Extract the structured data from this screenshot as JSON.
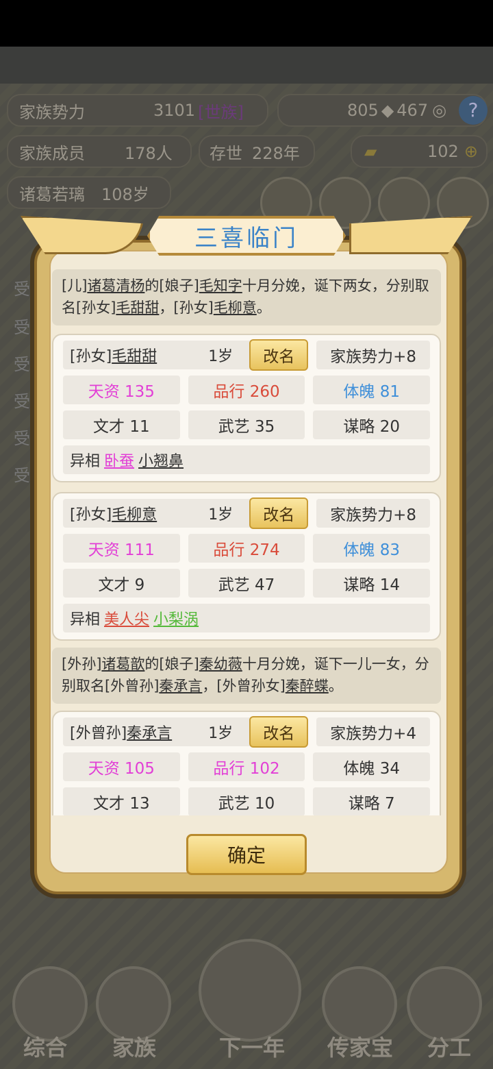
{
  "background": {
    "family_power_label": "家族势力",
    "family_power_value": "3101",
    "family_power_rank": "[世族]",
    "currency_a": "805",
    "currency_b": "467",
    "members_label": "家族成员",
    "members_value": "178人",
    "existence_label": "存世",
    "existence_value": "228年",
    "gold_value": "102",
    "patriarch_name": "诸葛若璃",
    "patriarch_age": "108岁",
    "side_labels": [
      "受",
      "受",
      "受",
      "受",
      "受",
      "受"
    ],
    "nav": [
      "综合",
      "家族",
      "下一年",
      "传家宝",
      "分工"
    ]
  },
  "modal": {
    "title": "三喜临门",
    "confirm_label": "确定",
    "events": [
      {
        "parts": [
          "[儿]",
          "诸葛清杨",
          "的[娘子]",
          "毛知字",
          "十月分娩，诞下两女，分别取名[孙女]",
          "毛甜甜",
          "，[孙女]",
          "毛柳意",
          "。"
        ]
      },
      {
        "parts": [
          "[外孙]",
          "诸葛歆",
          "的[娘子]",
          "秦幼薇",
          "十月分娩，诞下一儿一女，分别取名[外曾孙]",
          "秦承言",
          "，[外曾孙女]",
          "秦醉蝶",
          "。"
        ]
      }
    ],
    "children": [
      {
        "relation": "[孙女]",
        "name": "毛甜甜",
        "age": "1岁",
        "rename": "改名",
        "power": "家族势力+8",
        "talent": "天资 135",
        "conduct": "品行 260",
        "physique": "体魄 81",
        "literary": "文才 11",
        "martial": "武艺 35",
        "strategy": "谋略 20",
        "traits_label": "异相",
        "traits": [
          "卧蚕",
          "小翘鼻"
        ]
      },
      {
        "relation": "[孙女]",
        "name": "毛柳意",
        "age": "1岁",
        "rename": "改名",
        "power": "家族势力+8",
        "talent": "天资 111",
        "conduct": "品行 274",
        "physique": "体魄 83",
        "literary": "文才 9",
        "martial": "武艺 47",
        "strategy": "谋略 14",
        "traits_label": "异相",
        "traits": [
          "美人尖",
          "小梨涡"
        ]
      },
      {
        "relation": "[外曾孙]",
        "name": "秦承言",
        "age": "1岁",
        "rename": "改名",
        "power": "家族势力+4",
        "talent": "天资 105",
        "conduct": "品行 102",
        "physique": "体魄 34",
        "literary": "文才 13",
        "martial": "武艺 10",
        "strategy": "谋略 7"
      }
    ]
  },
  "colors": {
    "talent": "#e23fd6",
    "conduct_red": "#d94b3a",
    "conduct_pink": "#e23fd6",
    "physique_blue": "#3f8fd9",
    "trait_green": "#54b93a",
    "title_blue": "#3a83c8"
  }
}
